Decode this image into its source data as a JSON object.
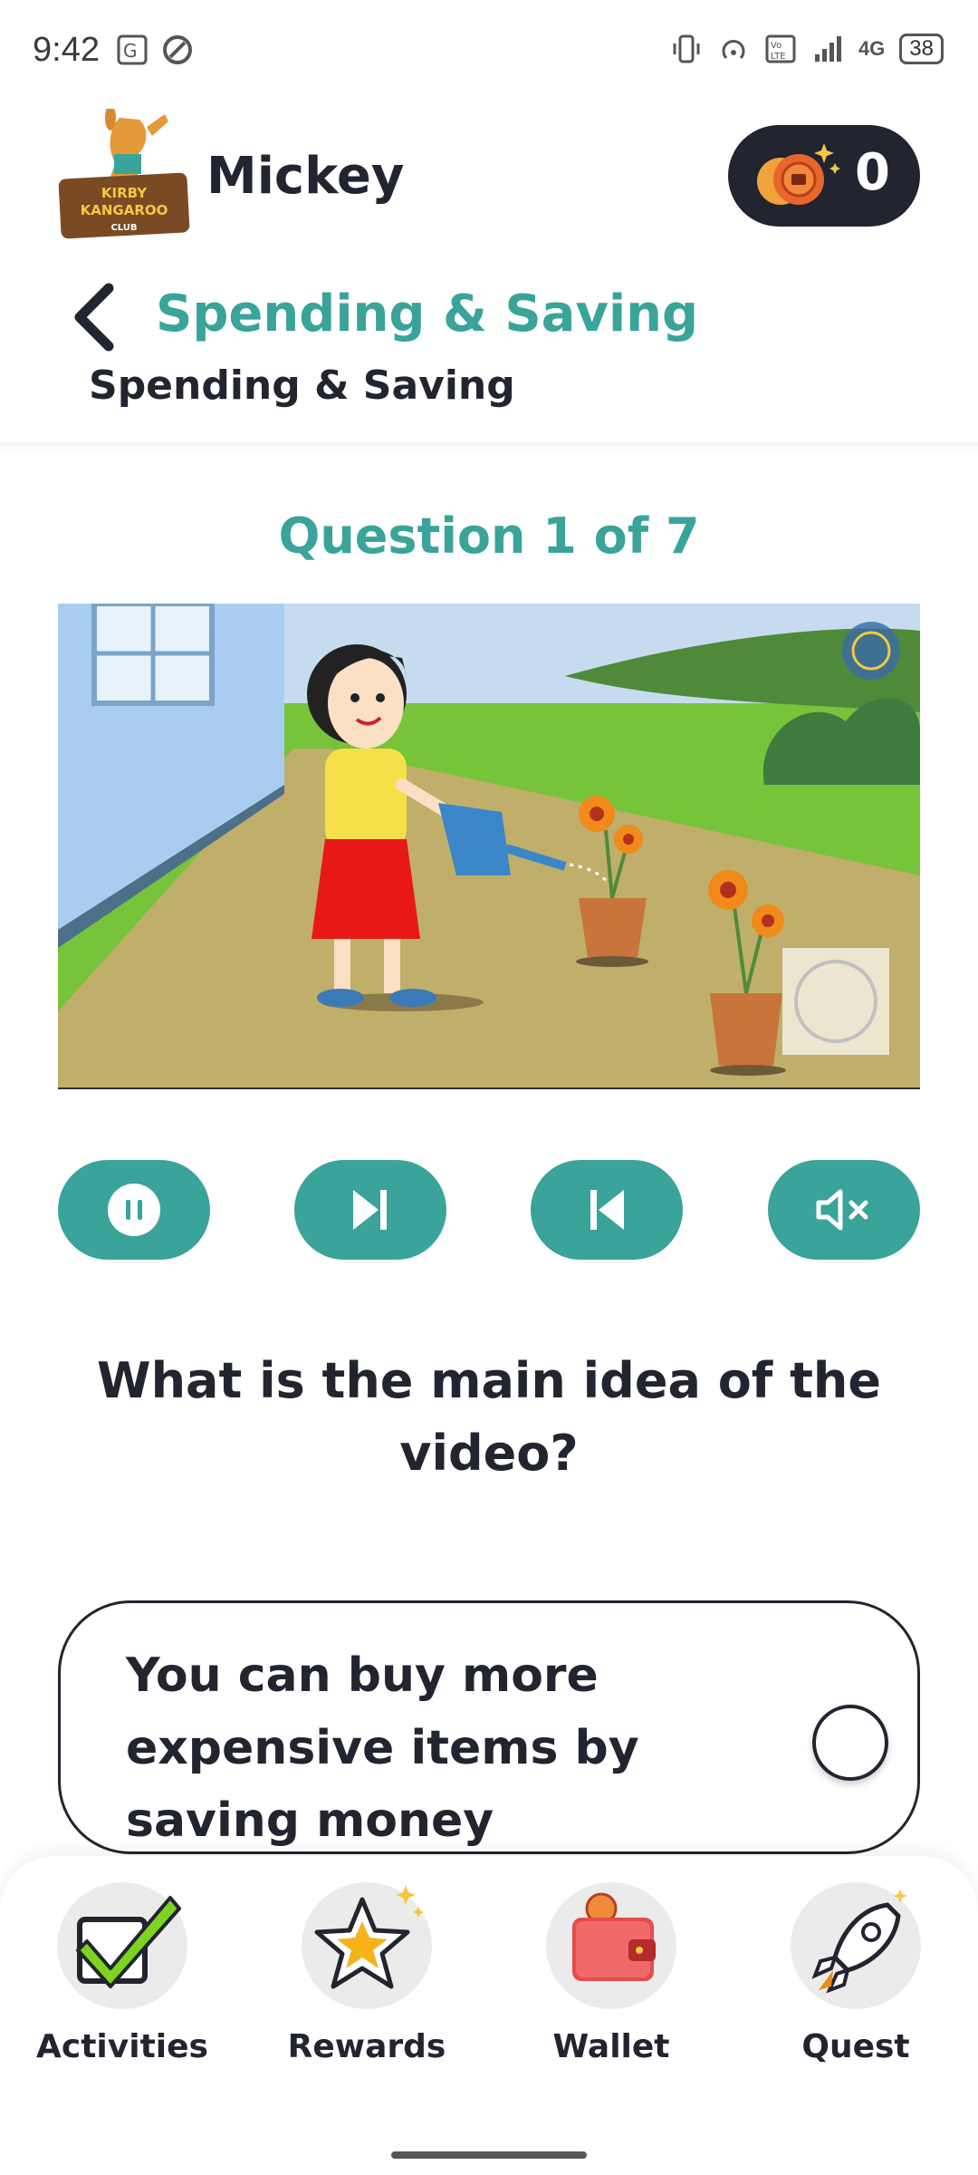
{
  "status_bar": {
    "time": "9:42",
    "battery": "38",
    "network": "4G",
    "icons": [
      "translate-icon",
      "data-saver-icon",
      "vibrate-icon",
      "hotspot-icon",
      "volte-icon",
      "signal-icon",
      "battery-icon"
    ]
  },
  "header": {
    "logo_text": [
      "KIRBY",
      "KANGAROO",
      "CLUB"
    ],
    "user_name": "Mickey",
    "coin_count": "0",
    "section_title": "Spending & Saving",
    "section_subtitle": "Spending & Saving"
  },
  "question": {
    "counter": "Question 1 of 7",
    "text": "What is the main idea of the video?",
    "answer_option": "You can buy more expensive items by saving money"
  },
  "controls": {
    "buttons": [
      "pause-button",
      "next-button",
      "previous-button",
      "mute-button"
    ]
  },
  "bottom_nav": {
    "items": [
      {
        "label": "Activities",
        "icon": "checkbox-icon"
      },
      {
        "label": "Rewards",
        "icon": "star-icon"
      },
      {
        "label": "Wallet",
        "icon": "wallet-icon"
      },
      {
        "label": "Quest",
        "icon": "rocket-icon"
      }
    ]
  },
  "colors": {
    "accent": "#3aa39a",
    "dark": "#22242f",
    "background": "#ffffff"
  }
}
